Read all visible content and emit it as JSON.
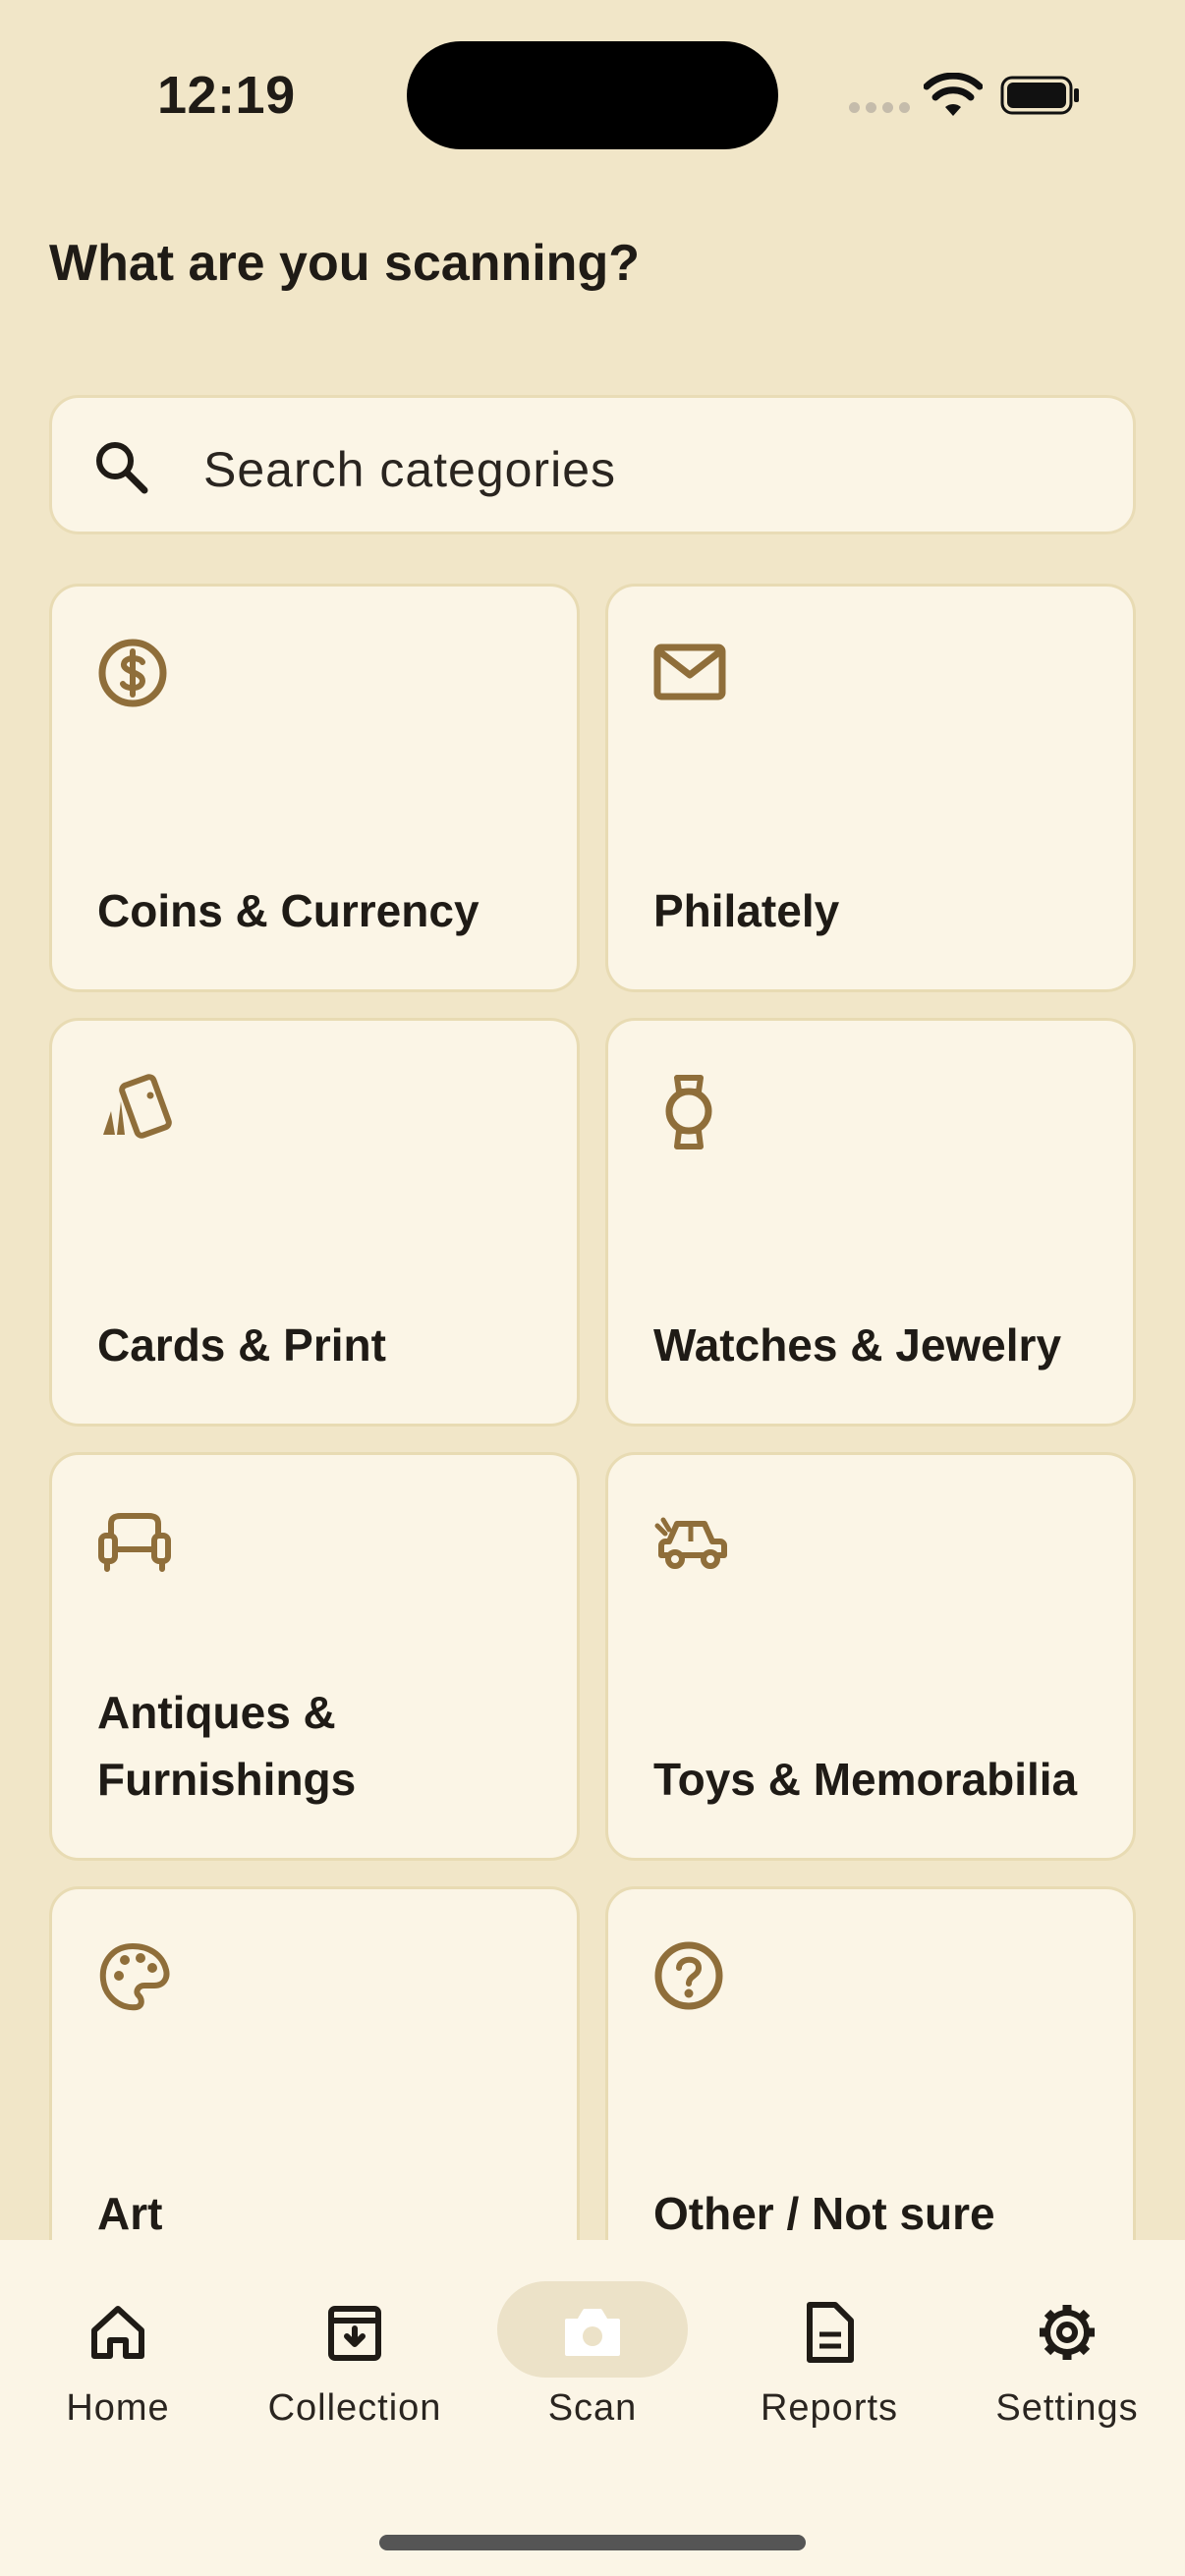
{
  "status_bar": {
    "time": "12:19"
  },
  "header": {
    "title": "What are you scanning?"
  },
  "search": {
    "placeholder": "Search categories"
  },
  "categories": [
    {
      "label": "Coins & Currency",
      "icon": "dollar-coin-icon"
    },
    {
      "label": "Philately",
      "icon": "envelope-icon"
    },
    {
      "label": "Cards & Print",
      "icon": "cards-icon"
    },
    {
      "label": "Watches & Jewelry",
      "icon": "watch-icon"
    },
    {
      "label": "Antiques & Furnishings",
      "icon": "armchair-icon"
    },
    {
      "label": "Toys & Memorabilia",
      "icon": "toy-car-icon"
    },
    {
      "label": "Art",
      "icon": "palette-icon"
    },
    {
      "label": "Other / Not sure",
      "icon": "question-circle-icon"
    }
  ],
  "bottom_nav": {
    "items": [
      {
        "label": "Home",
        "icon": "home-icon"
      },
      {
        "label": "Collection",
        "icon": "archive-icon"
      },
      {
        "label": "Scan",
        "icon": "camera-icon",
        "active": true
      },
      {
        "label": "Reports",
        "icon": "document-icon"
      },
      {
        "label": "Settings",
        "icon": "gear-icon"
      }
    ]
  },
  "colors": {
    "background": "#f1e6c8",
    "card": "#fbf5e6",
    "accent": "#8f6e3a",
    "text": "#1f1b16"
  }
}
